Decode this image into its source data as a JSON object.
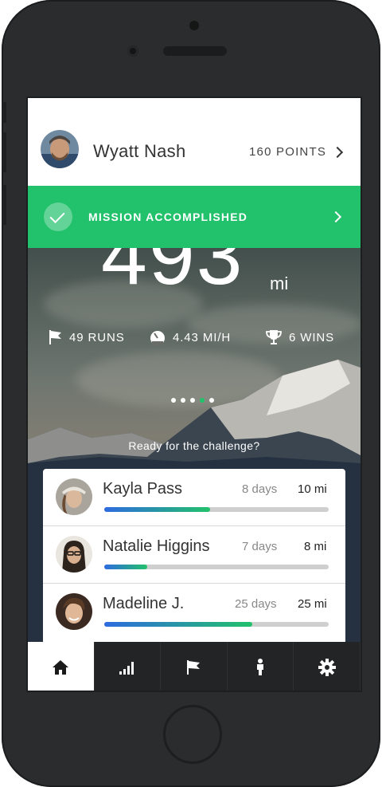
{
  "profile": {
    "name": "Wyatt Nash",
    "points": "160 POINTS"
  },
  "banner": {
    "text": "MISSION ACCOMPLISHED",
    "color": "#22c16b"
  },
  "hero": {
    "distance": "493",
    "unit": "mi",
    "stats": [
      {
        "icon": "flag-icon",
        "label": "49 RUNS"
      },
      {
        "icon": "speedometer-icon",
        "label": "4.43 MI/H"
      },
      {
        "icon": "trophy-icon",
        "label": "6 WINS"
      }
    ],
    "pager": {
      "count": 5,
      "active_index": 3
    },
    "prompt": "Ready for the challenge?"
  },
  "leaderboard": [
    {
      "name": "Kayla Pass",
      "days": "8 days",
      "miles": "10 mi",
      "progress": 0.47
    },
    {
      "name": "Natalie Higgins",
      "days": "7 days",
      "miles": "8 mi",
      "progress": 0.19
    },
    {
      "name": "Madeline J.",
      "days": "25 days",
      "miles": "25 mi",
      "progress": 0.66
    }
  ],
  "tabs": [
    {
      "icon": "home-icon",
      "active": true
    },
    {
      "icon": "signal-bars-icon",
      "active": false
    },
    {
      "icon": "flag-icon",
      "active": false
    },
    {
      "icon": "person-icon",
      "active": false
    },
    {
      "icon": "gear-icon",
      "active": false
    }
  ],
  "colors": {
    "accent": "#22c16b",
    "progress_start": "#2e6bdf",
    "tabbar": "#232425"
  }
}
